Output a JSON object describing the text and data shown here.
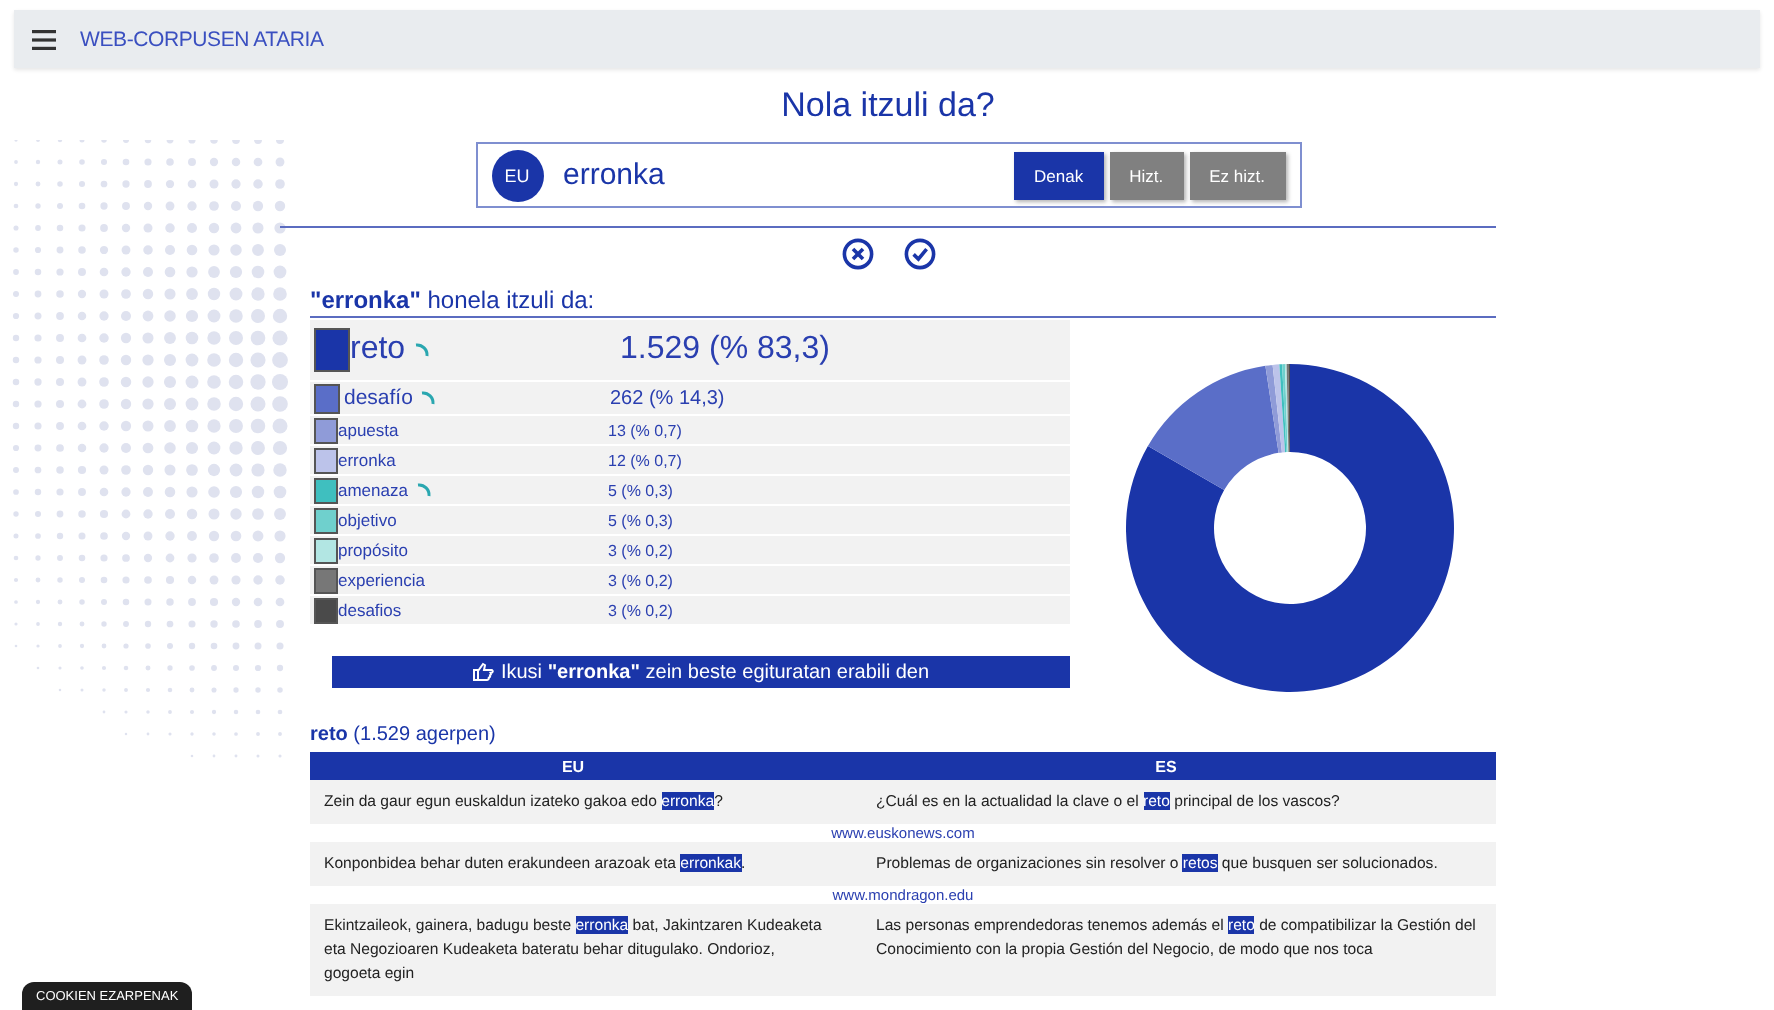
{
  "header": {
    "title": "WEB-CORPUSEN ATARIA"
  },
  "page_title": "Nola itzuli da?",
  "search": {
    "language": "EU",
    "value": "erronka",
    "filters": [
      {
        "label": "Denak",
        "selected": true
      },
      {
        "label": "Hizt.",
        "selected": false
      },
      {
        "label": "Ez hizt.",
        "selected": false
      }
    ]
  },
  "results": {
    "heading": "**\"erronka\"** honela itzuli da:",
    "translations": [
      {
        "kind": "large",
        "term": "reto",
        "count": "1.529 (% 83,3)",
        "color": "#1a35a8",
        "spinner": true
      },
      {
        "kind": "medium",
        "term": "desafío",
        "count": "262 (% 14,3)",
        "color": "#5a6ec8",
        "spinner": true
      },
      {
        "kind": "small",
        "term": "apuesta",
        "count": "13 (% 0,7)",
        "color": "#8f9bd8",
        "spinner": false
      },
      {
        "kind": "small",
        "term": "erronka",
        "count": "12 (% 0,7)",
        "color": "#bcc3ea",
        "spinner": false
      },
      {
        "kind": "small",
        "term": "amenaza",
        "count": "5 (% 0,3)",
        "color": "#3fbfbf",
        "spinner": true
      },
      {
        "kind": "small",
        "term": "objetivo",
        "count": "5 (% 0,3)",
        "color": "#6fd0cd",
        "spinner": false
      },
      {
        "kind": "small",
        "term": "propósito",
        "count": "3 (% 0,2)",
        "color": "#b2e6e3",
        "spinner": false
      },
      {
        "kind": "small",
        "term": "experiencia",
        "count": "3 (% 0,2)",
        "color": "#777777",
        "spinner": false
      },
      {
        "kind": "small",
        "term": "desafios",
        "count": "3 (% 0,2)",
        "color": "#4a4a4a",
        "spinner": false
      }
    ],
    "structures_button": "Ikusi **\"erronka\"** zein beste egituratan erabili den"
  },
  "examples": {
    "heading": "**reto** (1.529 agerpen)",
    "columns": [
      "EU",
      "ES"
    ],
    "rows": [
      {
        "eu": [
          {
            "text": "Zein da gaur egun euskaldun izateko gakoa edo "
          },
          {
            "text": "erronka",
            "hl": true
          },
          {
            "text": "?"
          }
        ],
        "es": [
          {
            "text": "¿Cuál es en la actualidad la clave o el "
          },
          {
            "text": "reto",
            "hl": true
          },
          {
            "text": " principal de los vascos?"
          }
        ],
        "source": "www.euskonews.com"
      },
      {
        "eu": [
          {
            "text": "Konponbidea behar duten erakundeen arazoak eta "
          },
          {
            "text": "erronkak",
            "hl": true
          },
          {
            "text": "."
          }
        ],
        "es": [
          {
            "text": "Problemas de organizaciones sin resolver o "
          },
          {
            "text": "retos",
            "hl": true
          },
          {
            "text": " que busquen ser solucionados."
          }
        ],
        "source": "www.mondragon.edu"
      },
      {
        "eu": [
          {
            "text": "Ekintzaileok, gainera, badugu beste "
          },
          {
            "text": "erronka",
            "hl": true
          },
          {
            "text": " bat, Jakintzaren Kudeaketa eta Negozioaren Kudeaketa bateratu behar ditugulako. Ondorioz, gogoeta egin"
          }
        ],
        "es": [
          {
            "text": "Las personas emprendedoras tenemos además el "
          },
          {
            "text": "reto",
            "hl": true
          },
          {
            "text": " de compatibilizar la Gestión del Conocimiento con la propia Gestión del Negocio, de modo que nos toca"
          }
        ]
      }
    ]
  },
  "cookie_button": "COOKIEN EZARPENAK"
}
